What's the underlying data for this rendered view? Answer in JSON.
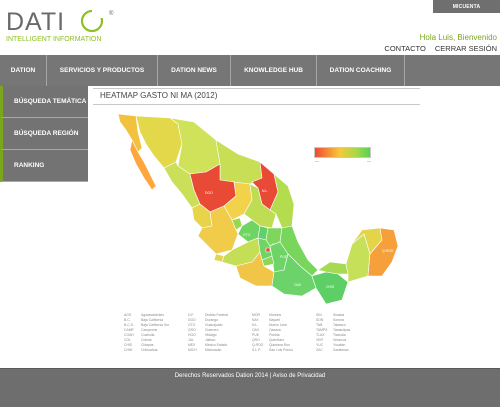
{
  "brand": {
    "name": "DATIO",
    "tagline": "INTELLIGENT INFORMATION",
    "reg": "®",
    "accent": "#8fbf26"
  },
  "header": {
    "account_button": "MICUENTA",
    "greeting": "Hola Luis, Bienvenido",
    "links": [
      "CONTACTO",
      "CERRAR SESIÓN"
    ]
  },
  "nav": {
    "items": [
      "DATION",
      "SERVICIOS Y PRODUCTOS",
      "DATION NEWS",
      "KNOWLEDGE HUB",
      "DATION COACHING"
    ]
  },
  "sidebar": {
    "items": [
      "BÚSQUEDA TEMÁTICA",
      "BÚSQUEDA REGIÓN",
      "RANKING"
    ]
  },
  "main": {
    "title": "HEATMAP GASTO NI MA (2012)",
    "legend": {
      "colors": [
        "#ee4a33",
        "#f6c93a",
        "#a9d848",
        "#56d256"
      ],
      "min_label": "—",
      "max_label": "—"
    }
  },
  "map_colors": {
    "bc": "#f2c13e",
    "bcs": "#ffa63e",
    "son": "#e3d74a",
    "chih": "#cfe25a",
    "coah": "#c8de55",
    "nl": "#e8e35a",
    "tamps": "#b3dd4e",
    "sin": "#cbe058",
    "dur": "#e84a36",
    "zac": "#f2d24a",
    "sic": "#f3a23c",
    "nay": "#e7d44a",
    "jal": "#f0cc4a",
    "ags": "#98d84e",
    "gto": "#6fd462",
    "qro": "#62d06a",
    "hgo": "#7ed65c",
    "mich": "#c4de55",
    "col": "#e4d64c",
    "mex": "#6ed466",
    "df": "#e84a36",
    "mor": "#8ad858",
    "gro": "#f0c548",
    "pue": "#6ed466",
    "tlax": "#86d75c",
    "ver": "#79d65c",
    "oax": "#6bd36a",
    "chis": "#5ecf64",
    "tab": "#a5da52",
    "camp": "#c7e05a",
    "yuc": "#e4d44a",
    "qroo": "#f5a03a",
    "nl_red": "#e84a36",
    "slp": "#bfdd52"
  },
  "codes": [
    [
      [
        "AGS",
        "Aguascalientes"
      ],
      [
        "B.C.",
        "Baja California"
      ],
      [
        "B.C.S.",
        "Baja California Sur"
      ],
      [
        "CAMP",
        "Campeche"
      ],
      [
        "COAH",
        "Coahuila"
      ],
      [
        "COL",
        "Colima"
      ],
      [
        "CHIS",
        "Chiapas"
      ],
      [
        "CHIH",
        "Chihuahua"
      ]
    ],
    [
      [
        "D.F.",
        "Distrito Federal"
      ],
      [
        "DGO",
        "Durango"
      ],
      [
        "GTO",
        "Guanajuato"
      ],
      [
        "GRO",
        "Guerrero"
      ],
      [
        "HGO",
        "Hidalgo"
      ],
      [
        "JAL",
        "Jalisco"
      ],
      [
        "MEX",
        "México Estado"
      ],
      [
        "MICH",
        "Michoacán"
      ]
    ],
    [
      [
        "MOR",
        "Morelos"
      ],
      [
        "NAY",
        "Nayarit"
      ],
      [
        "N.L.",
        "Nuevo León"
      ],
      [
        "OAX",
        "Oaxaca"
      ],
      [
        "PUE",
        "Puebla"
      ],
      [
        "QRO",
        "Querétaro"
      ],
      [
        "Q.ROO",
        "Quintana Roo"
      ],
      [
        "S.L.P.",
        "San Luis Potosí"
      ]
    ],
    [
      [
        "SIN",
        "Sinaloa"
      ],
      [
        "SON",
        "Sonora"
      ],
      [
        "TAB",
        "Tabasco"
      ],
      [
        "TAMPS",
        "Tamaulipas"
      ],
      [
        "TLAX",
        "Tlaxcala"
      ],
      [
        "VER",
        "Veracruz"
      ],
      [
        "YUC",
        "Yucatán"
      ],
      [
        "ZAC",
        "Zacatecas"
      ]
    ]
  ],
  "footer": {
    "text": "Derechos Reservados Dation 2014 | Aviso de Privacidad"
  }
}
